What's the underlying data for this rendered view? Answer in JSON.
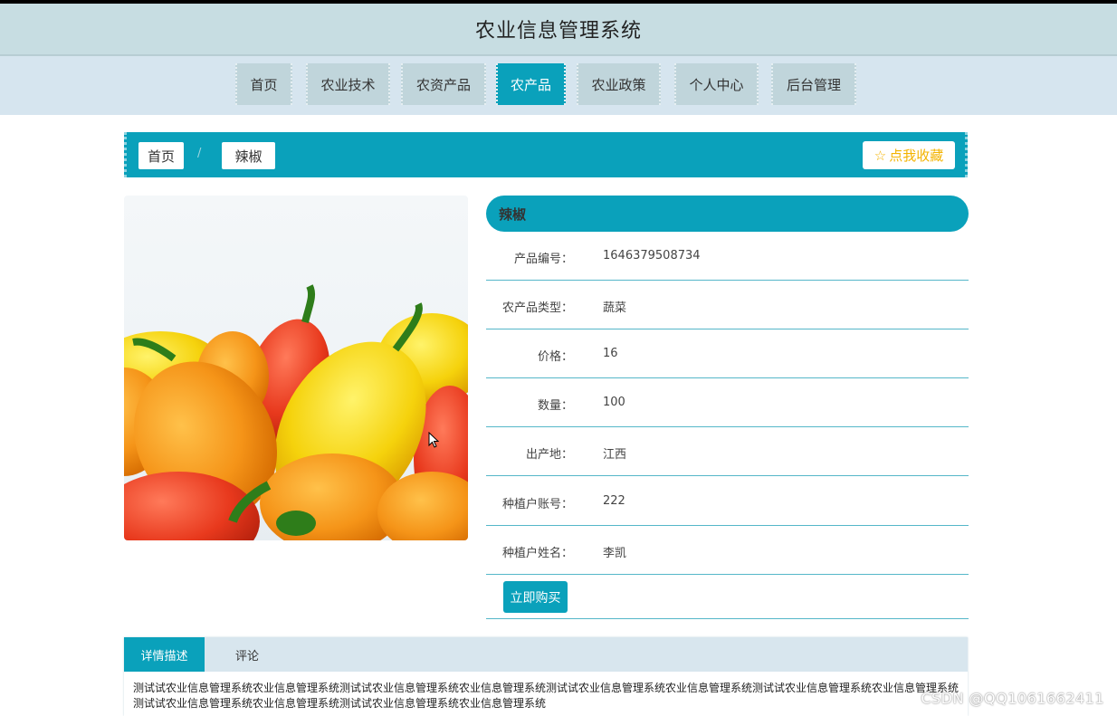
{
  "header": {
    "title": "农业信息管理系统"
  },
  "nav": {
    "items": [
      {
        "label": "首页"
      },
      {
        "label": "农业技术"
      },
      {
        "label": "农资产品"
      },
      {
        "label": "农产品"
      },
      {
        "label": "农业政策"
      },
      {
        "label": "个人中心"
      },
      {
        "label": "后台管理"
      }
    ],
    "active": "农产品"
  },
  "breadcrumb": {
    "home": "首页",
    "separator": "/",
    "current": "辣椒"
  },
  "favorite": {
    "icon": "star-icon",
    "label": "点我收藏"
  },
  "product": {
    "name": "辣椒",
    "image": "peppers-photo",
    "fields": [
      {
        "label": "产品编号：",
        "value": "1646379508734"
      },
      {
        "label": "农产品类型：",
        "value": "蔬菜"
      },
      {
        "label": "价格：",
        "value": "16"
      },
      {
        "label": "数量：",
        "value": "100"
      },
      {
        "label": "出产地：",
        "value": "江西"
      },
      {
        "label": "种植户账号：",
        "value": "222"
      },
      {
        "label": "种植户姓名：",
        "value": "李凯"
      }
    ],
    "buy_label": "立即购买"
  },
  "tabs": {
    "items": [
      {
        "label": "详情描述"
      },
      {
        "label": "评论"
      }
    ],
    "active": "详情描述",
    "description": "测试试农业信息管理系统农业信息管理系统测试试农业信息管理系统农业信息管理系统测试试农业信息管理系统农业信息管理系统测试试农业信息管理系统农业信息管理系统测试试农业信息管理系统农业信息管理系统测试试农业信息管理系统农业信息管理系统"
  },
  "watermark": "CSDN @QQ1061662411",
  "colors": {
    "accent": "#0aa1bb",
    "header_bg": "#c7dde2",
    "nav_bg": "#d6e5ef",
    "favorite": "#f3b300"
  }
}
